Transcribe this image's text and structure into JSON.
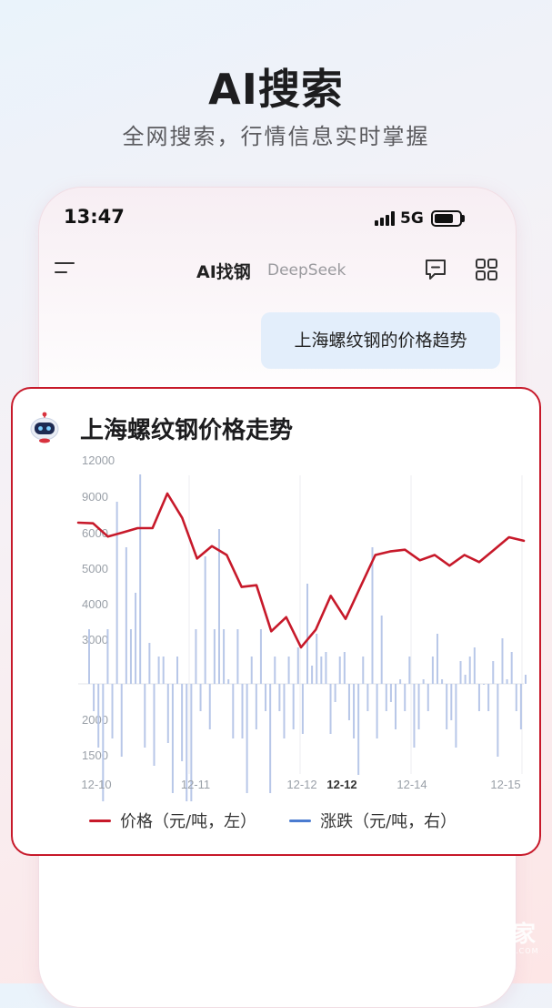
{
  "hero": {
    "title": "AI搜索",
    "subtitle": "全网搜索，行情信息实时掌握"
  },
  "status_bar": {
    "time": "13:47",
    "network": "5G"
  },
  "app_bar": {
    "title": "AI找钢",
    "model": "DeepSeek"
  },
  "chat": {
    "user_message": "上海螺纹钢的价格趋势"
  },
  "card": {
    "title": "上海螺纹钢价格走势"
  },
  "colors": {
    "price_line": "#c7192a",
    "change_bar": "#b8c7e8",
    "card_border": "#c7192a",
    "legend_change": "#4a7bd0"
  },
  "chart_data": {
    "type": "line+bar",
    "y_tick_labels_top": [
      "12000",
      "9000",
      "6000",
      "5000",
      "4000",
      "3000"
    ],
    "y_tick_labels_bottom": [
      "2000",
      "1500"
    ],
    "x_tick_labels": [
      "12-10",
      "12-11",
      "12-12",
      "12-12",
      "12-14",
      "12-15"
    ],
    "x_tick_bold_index": 3,
    "series": [
      {
        "name": "价格（元/吨，左）",
        "type": "line",
        "values": [
          7200,
          7150,
          6050,
          6400,
          6750,
          6750,
          9600,
          7600,
          5400,
          5750,
          5500,
          4600,
          4650,
          3350,
          3750,
          2900,
          3400,
          4350,
          3700,
          4600,
          5500,
          5600,
          5650,
          5350,
          5500,
          5200,
          5500,
          5300,
          5650,
          6000,
          5900
        ]
      },
      {
        "name": "涨跌（元/吨，右）",
        "type": "bar",
        "values": [
          60,
          -30,
          -70,
          -140,
          60,
          -60,
          200,
          -80,
          150,
          60,
          100,
          230,
          -70,
          45,
          -90,
          30,
          30,
          -65,
          -120,
          30,
          -85,
          -150,
          -140,
          60,
          -30,
          140,
          -50,
          60,
          170,
          60,
          5,
          -60,
          60,
          -60,
          -120,
          30,
          -50,
          60,
          -30,
          -120,
          30,
          -30,
          -60,
          30,
          -50,
          40,
          -55,
          110,
          20,
          55,
          30,
          35,
          -55,
          -20,
          30,
          35,
          -40,
          -60,
          -100,
          30,
          -30,
          150,
          -60,
          75,
          -30,
          -20,
          -50,
          5,
          -30,
          30,
          -70,
          -50,
          5,
          -30,
          30,
          55,
          5,
          -50,
          -40,
          -70,
          25,
          10,
          30,
          40,
          -30,
          0,
          -30,
          25,
          -80,
          50,
          5,
          35,
          -30,
          -50,
          10
        ]
      }
    ],
    "legend_position": "bottom"
  },
  "watermark": {
    "text": "硬件之家",
    "sub": "YING JIAN ZHI JIA.COM"
  }
}
